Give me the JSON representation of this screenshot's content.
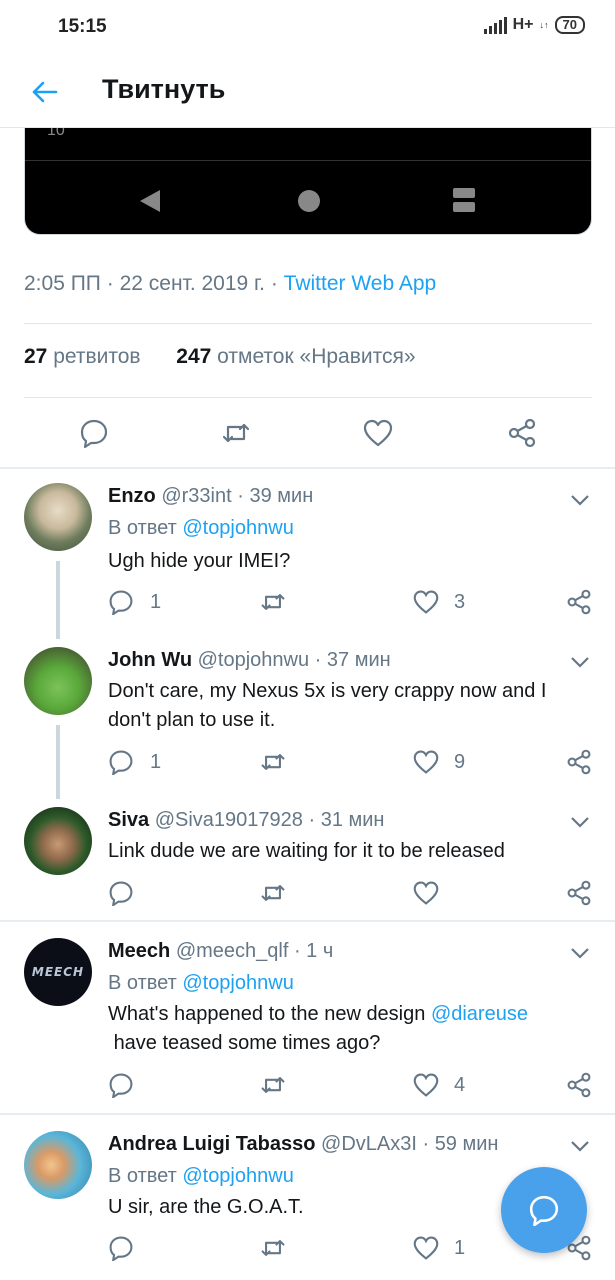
{
  "status_bar": {
    "time": "15:15",
    "network": "H+",
    "network_sub": "↓↑",
    "battery": "70"
  },
  "header": {
    "title": "Твитнуть"
  },
  "media": {
    "partial_text": "10"
  },
  "tweet": {
    "time": "2:05 ПП",
    "date": "22 сент. 2019 г.",
    "source": "Twitter Web App",
    "retweets_count": "27",
    "retweets_label": "ретвитов",
    "likes_count": "247",
    "likes_label": "отметок «Нравится»"
  },
  "replies": [
    {
      "name": "Enzo",
      "handle": "@r33int",
      "time": "39 мин",
      "reply_to_prefix": "В ответ",
      "reply_to": "@topjohnwu",
      "text": "Ugh hide your IMEI?",
      "reply_count": "1",
      "retweet_count": "",
      "like_count": "3"
    },
    {
      "name": "John Wu",
      "handle": "@topjohnwu",
      "time": "37 мин",
      "text": "Don't care, my Nexus 5x is very crappy now and I don't plan to use it.",
      "reply_count": "1",
      "retweet_count": "",
      "like_count": "9"
    },
    {
      "name": "Siva",
      "handle": "@Siva19017928",
      "time": "31 мин",
      "text": "Link dude we are waiting for it to be released",
      "reply_count": "",
      "retweet_count": "",
      "like_count": ""
    },
    {
      "name": "Meech",
      "handle": "@meech_qlf",
      "time": "1 ч",
      "reply_to_prefix": "В ответ",
      "reply_to": "@topjohnwu",
      "text_before": "What's happened to the new design",
      "mention": "@diareuse",
      "text_after": "have teased some times ago?",
      "reply_count": "",
      "retweet_count": "",
      "like_count": "4",
      "avatar_text": "MEECH"
    },
    {
      "name": "Andrea Luigi Tabasso",
      "handle": "@DvLAx3I",
      "time": "59 мин",
      "reply_to_prefix": "В ответ",
      "reply_to": "@topjohnwu",
      "text": "U sir, are the G.O.A.T.",
      "reply_count": "",
      "retweet_count": "",
      "like_count": "1"
    }
  ],
  "colors": {
    "accent": "#1da1f2",
    "fab": "#4aa1eb",
    "secondary_text": "#657786"
  }
}
